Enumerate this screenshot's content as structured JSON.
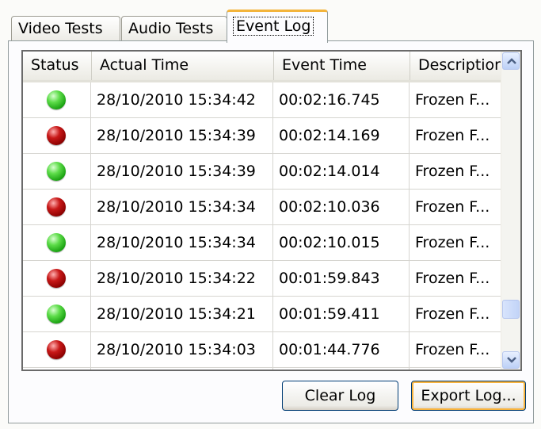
{
  "tabs": [
    {
      "label": "Video Tests"
    },
    {
      "label": "Audio Tests"
    },
    {
      "label": "Event Log"
    }
  ],
  "active_tab": "Event Log",
  "columns": [
    "Status",
    "Actual Time",
    "Event Time",
    "Descriptior"
  ],
  "rows": [
    {
      "status": "green",
      "actual_time": "28/10/2010 15:34:42",
      "event_time": "00:02:16.745",
      "description": "Frozen F..."
    },
    {
      "status": "red",
      "actual_time": "28/10/2010 15:34:39",
      "event_time": "00:02:14.169",
      "description": "Frozen F..."
    },
    {
      "status": "green",
      "actual_time": "28/10/2010 15:34:39",
      "event_time": "00:02:14.014",
      "description": "Frozen F..."
    },
    {
      "status": "red",
      "actual_time": "28/10/2010 15:34:34",
      "event_time": "00:02:10.036",
      "description": "Frozen F..."
    },
    {
      "status": "green",
      "actual_time": "28/10/2010 15:34:34",
      "event_time": "00:02:10.015",
      "description": "Frozen F..."
    },
    {
      "status": "red",
      "actual_time": "28/10/2010 15:34:22",
      "event_time": "00:01:59.843",
      "description": "Frozen F..."
    },
    {
      "status": "green",
      "actual_time": "28/10/2010 15:34:21",
      "event_time": "00:01:59.411",
      "description": "Frozen F..."
    },
    {
      "status": "red",
      "actual_time": "28/10/2010 15:34:03",
      "event_time": "00:01:44.776",
      "description": "Frozen F..."
    },
    {
      "status": "green",
      "actual_time": "",
      "event_time": "",
      "description": ""
    }
  ],
  "buttons": {
    "clear_label": "Clear Log",
    "export_label": "Export Log..."
  },
  "colors": {
    "active_tab_accent": "#f3b43b",
    "status_green": "#22b014",
    "status_red": "#a00000",
    "scrollbar": "#c2d4f8"
  },
  "icons": {
    "scroll_up": "chevron-up-icon",
    "scroll_down": "chevron-down-icon"
  }
}
